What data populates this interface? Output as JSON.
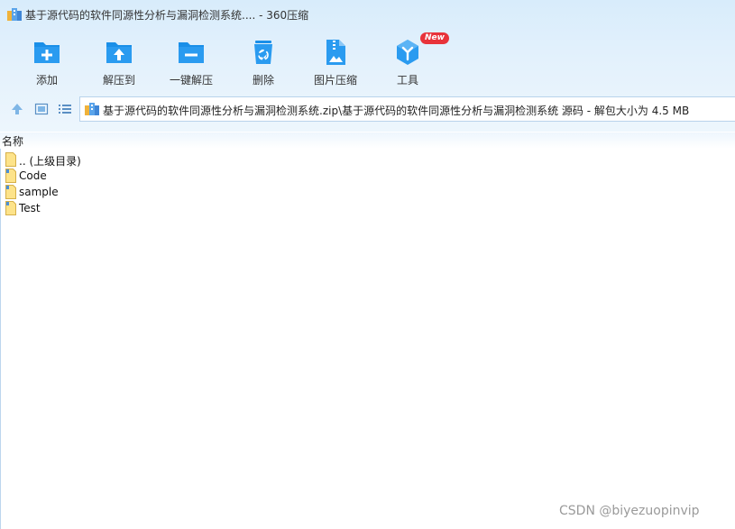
{
  "window": {
    "title": "基于源代码的软件同源性分析与漏洞检测系统.... - 360压缩"
  },
  "toolbar": {
    "items": [
      {
        "label": "添加",
        "icon": "folder-add-icon"
      },
      {
        "label": "解压到",
        "icon": "folder-extract-icon"
      },
      {
        "label": "一键解压",
        "icon": "one-click-extract-icon"
      },
      {
        "label": "删除",
        "icon": "recycle-bin-icon"
      },
      {
        "label": "图片压缩",
        "icon": "image-compress-icon"
      },
      {
        "label": "工具",
        "icon": "tools-cube-icon",
        "badge": "New"
      }
    ]
  },
  "address": {
    "path": "基于源代码的软件同源性分析与漏洞检测系统.zip\\基于源代码的软件同源性分析与漏洞检测系统 源码 - 解包大小为 4.5 MB"
  },
  "columns": {
    "name": "名称"
  },
  "files": [
    {
      "name": ".. (上级目录)",
      "type": "parent"
    },
    {
      "name": "Code",
      "type": "folder"
    },
    {
      "name": "sample",
      "type": "folder"
    },
    {
      "name": "Test",
      "type": "folder"
    }
  ],
  "watermark": "CSDN @biyezuopinvip",
  "colors": {
    "accent": "#1a8fe8",
    "badge": "#e8333a",
    "folder": "#fde38a"
  }
}
